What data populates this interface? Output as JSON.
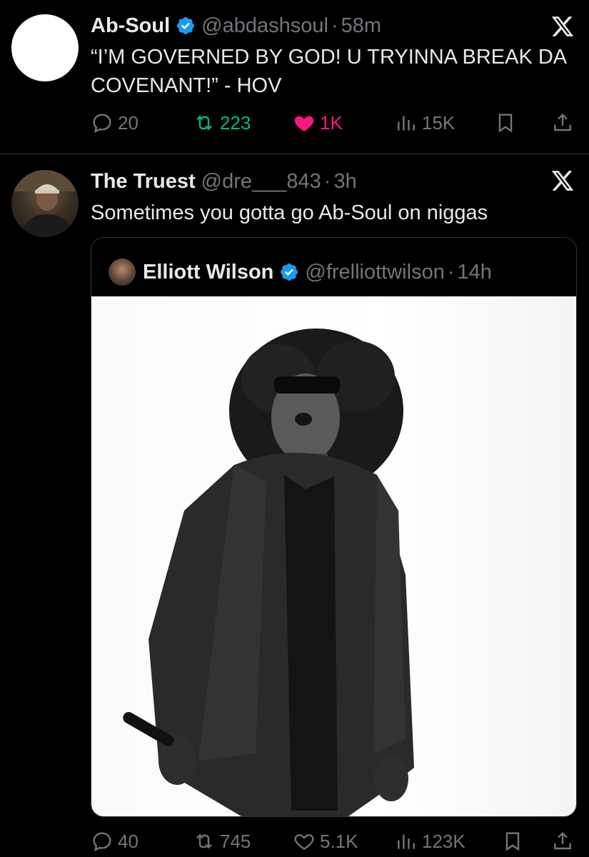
{
  "tweets": [
    {
      "author": {
        "name": "Ab-Soul",
        "handle": "@abdashsoul",
        "verified": true
      },
      "time": "58m",
      "text": "“I’M GOVERNED BY GOD! U TRYINNA BREAK DA COVENANT!” - HOV",
      "actions": {
        "replies": "20",
        "reposts": "223",
        "likes": "1K",
        "views": "15K"
      },
      "liked": true,
      "reposted": true
    },
    {
      "author": {
        "name": "The Truest",
        "handle": "@dre___843",
        "verified": false
      },
      "time": "3h",
      "text": "Sometimes you gotta go Ab-Soul on niggas",
      "quoted": {
        "author": {
          "name": "Elliott Wilson",
          "handle": "@frelliottwilson",
          "verified": true
        },
        "time": "14h"
      },
      "actions": {
        "replies": "40",
        "reposts": "745",
        "likes": "5.1K",
        "views": "123K"
      },
      "liked": false,
      "reposted": false
    }
  ],
  "separator": "·",
  "colors": {
    "background": "#000000",
    "text_primary": "#e7e9ea",
    "text_secondary": "#71767b",
    "verified_blue": "#1d9bf0",
    "like_pink": "#f91880",
    "repost_green": "#00ba7c",
    "divider": "#2f3336"
  },
  "icons": [
    "x-logo-icon",
    "verified-badge-icon",
    "reply-icon",
    "repost-icon",
    "like-icon",
    "views-icon",
    "bookmark-icon",
    "share-icon"
  ]
}
